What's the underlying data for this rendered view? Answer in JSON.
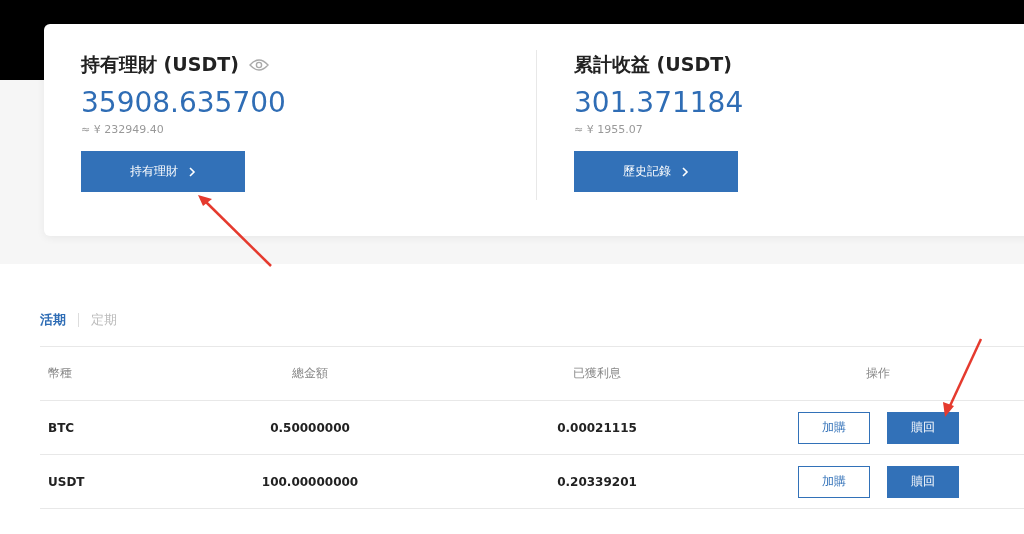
{
  "cards": [
    {
      "title": "持有理財 (USDT)",
      "eye_icon": true,
      "value": "35908.635700",
      "approx": "≈ ¥ 232949.40",
      "button": "持有理財"
    },
    {
      "title": "累計收益 (USDT)",
      "value": "301.371184",
      "approx": "≈ ¥ 1955.07",
      "button": "歷史記錄"
    }
  ],
  "tabs": [
    {
      "label": "活期",
      "selected": true
    },
    {
      "label": "定期",
      "selected": false
    }
  ],
  "table": {
    "columns": [
      "幣種",
      "總金額",
      "已獲利息",
      "操作"
    ],
    "rows": [
      {
        "cells": [
          "BTC",
          "0.50000000",
          "0.00021115"
        ],
        "actions": [
          {
            "label": "加購",
            "kind": "outline"
          },
          {
            "label": "贖回",
            "kind": "primary"
          }
        ]
      },
      {
        "cells": [
          "USDT",
          "100.00000000",
          "0.20339201"
        ],
        "actions": [
          {
            "label": "加購",
            "kind": "outline"
          },
          {
            "label": "贖回",
            "kind": "primary"
          }
        ]
      }
    ]
  }
}
